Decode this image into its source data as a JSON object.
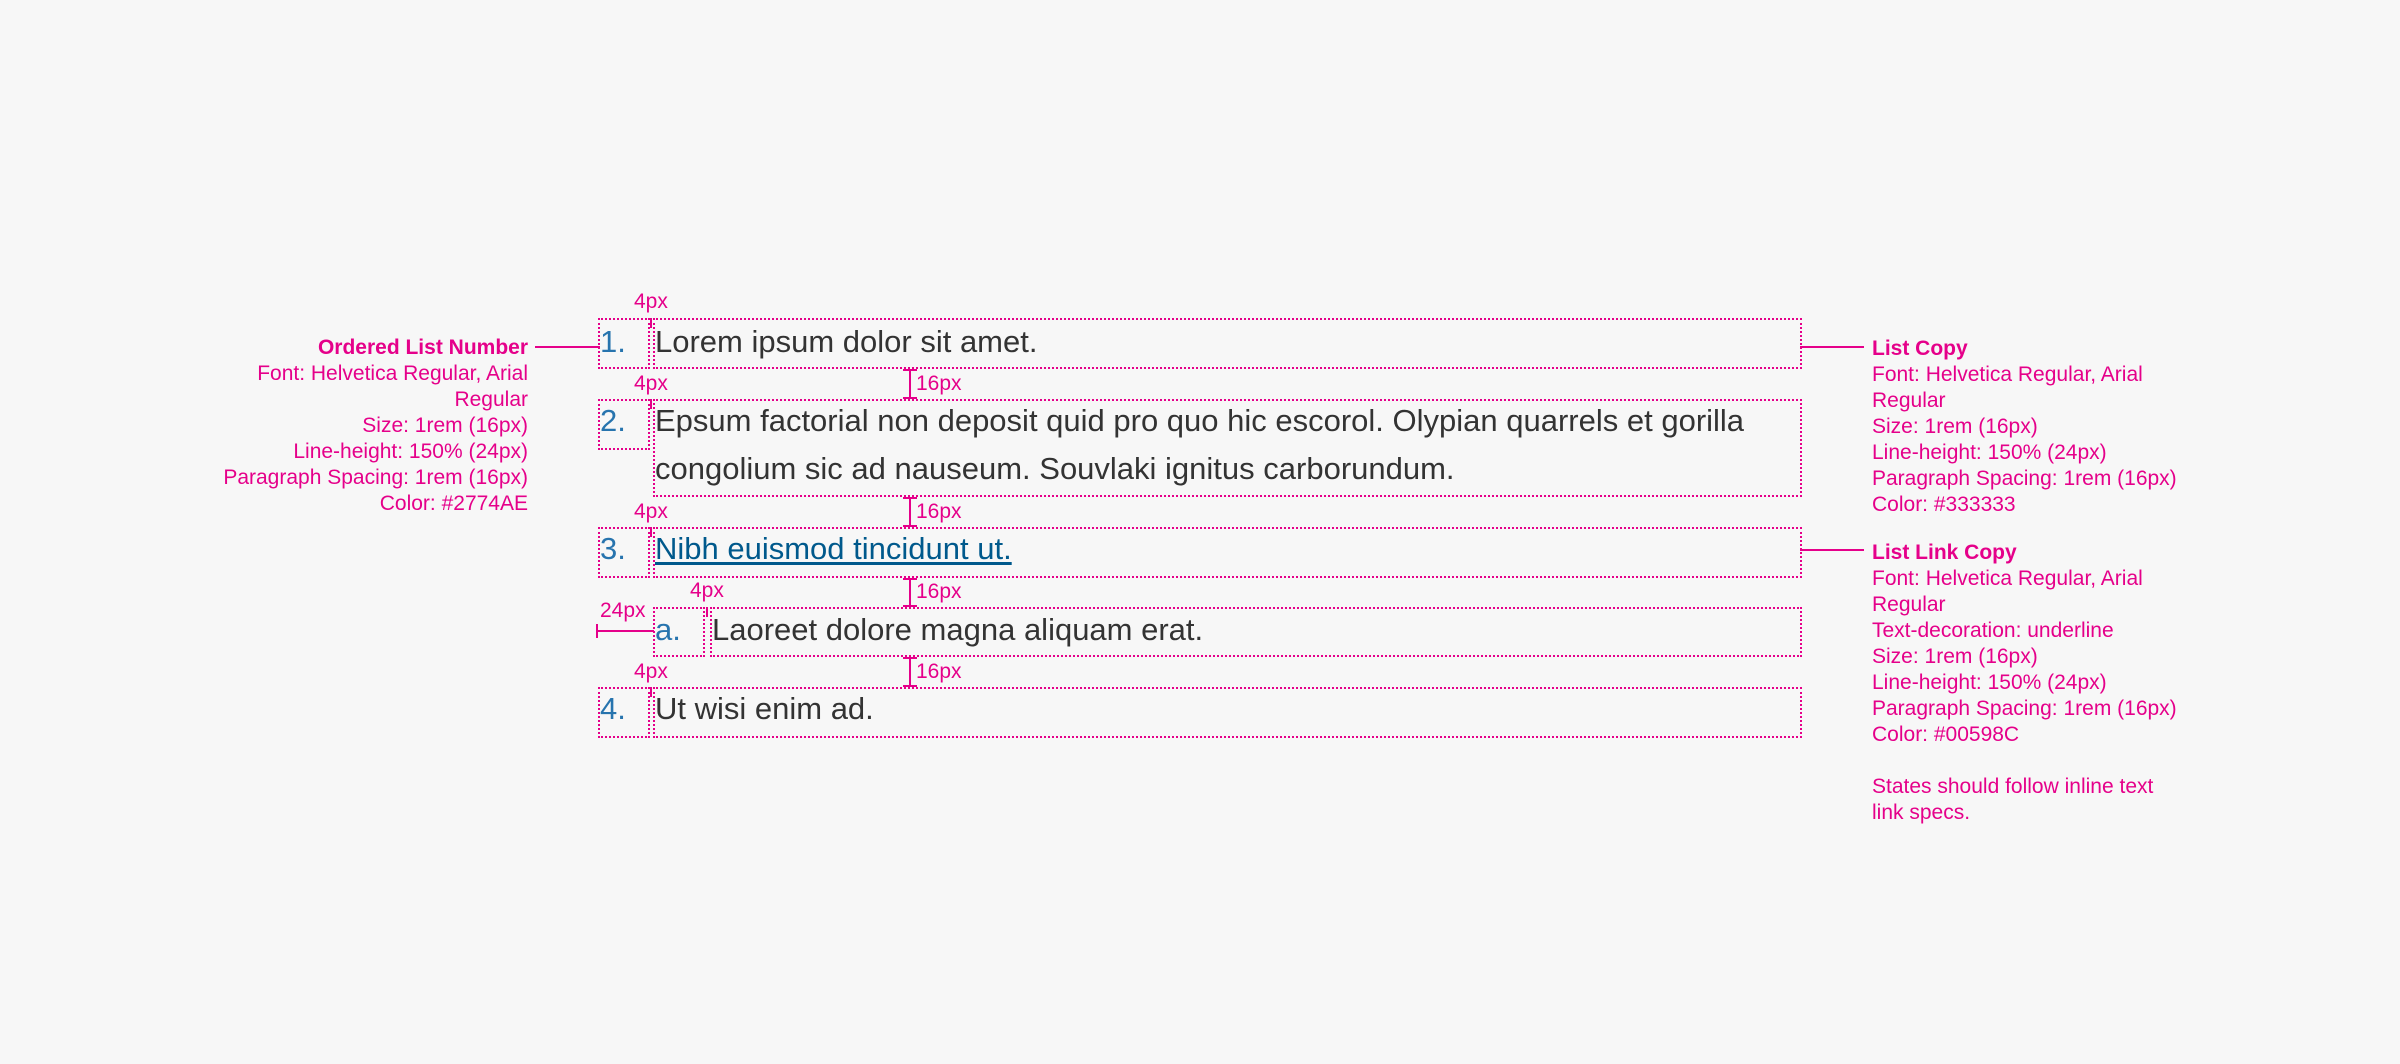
{
  "list": {
    "items": [
      {
        "number": "1.",
        "text": "Lorem ipsum dolor sit amet."
      },
      {
        "number": "2.",
        "text_line1": "Epsum factorial non deposit quid pro quo hic escorol. Olypian quarrels et gorilla",
        "text_line2": "congolium sic ad nauseum. Souvlaki ignitus carborundum."
      },
      {
        "number": "3.",
        "text": "Nibh euismod tincidunt ut."
      },
      {
        "number": "a.",
        "text": "Laoreet dolore magna aliquam erat."
      },
      {
        "number": "4.",
        "text": "Ut wisi enim ad."
      }
    ]
  },
  "dimensions": {
    "gap_4px": "4px",
    "gap_16px": "16px",
    "indent_24px": "24px"
  },
  "specs": {
    "number": {
      "title": "Ordered List Number",
      "font_line1": "Font: Helvetica Regular, Arial",
      "font_line2": "Regular",
      "size": "Size: 1rem (16px)",
      "line_height": "Line-height: 150% (24px)",
      "spacing": "Paragraph Spacing: 1rem (16px)",
      "color": "Color: #2774AE"
    },
    "copy": {
      "title": "List Copy",
      "font_line1": "Font: Helvetica Regular, Arial",
      "font_line2": "Regular",
      "size": "Size: 1rem (16px)",
      "line_height": "Line-height: 150% (24px)",
      "spacing": "Paragraph Spacing: 1rem (16px)",
      "color": "Color: #333333"
    },
    "link": {
      "title": "List Link Copy",
      "font_line1": "Font: Helvetica Regular, Arial",
      "font_line2": "Regular",
      "decoration": "Text-decoration: underline",
      "size": "Size: 1rem (16px)",
      "line_height": "Line-height: 150% (24px)",
      "spacing": "Paragraph Spacing: 1rem (16px)",
      "color": "Color: #00598C",
      "note_line1": "States should follow inline text",
      "note_line2": "link specs."
    }
  },
  "colors": {
    "annotation": "#e5008a",
    "number": "#2774ae",
    "copy": "#333333",
    "link": "#00598c",
    "background": "#f7f7f7"
  }
}
